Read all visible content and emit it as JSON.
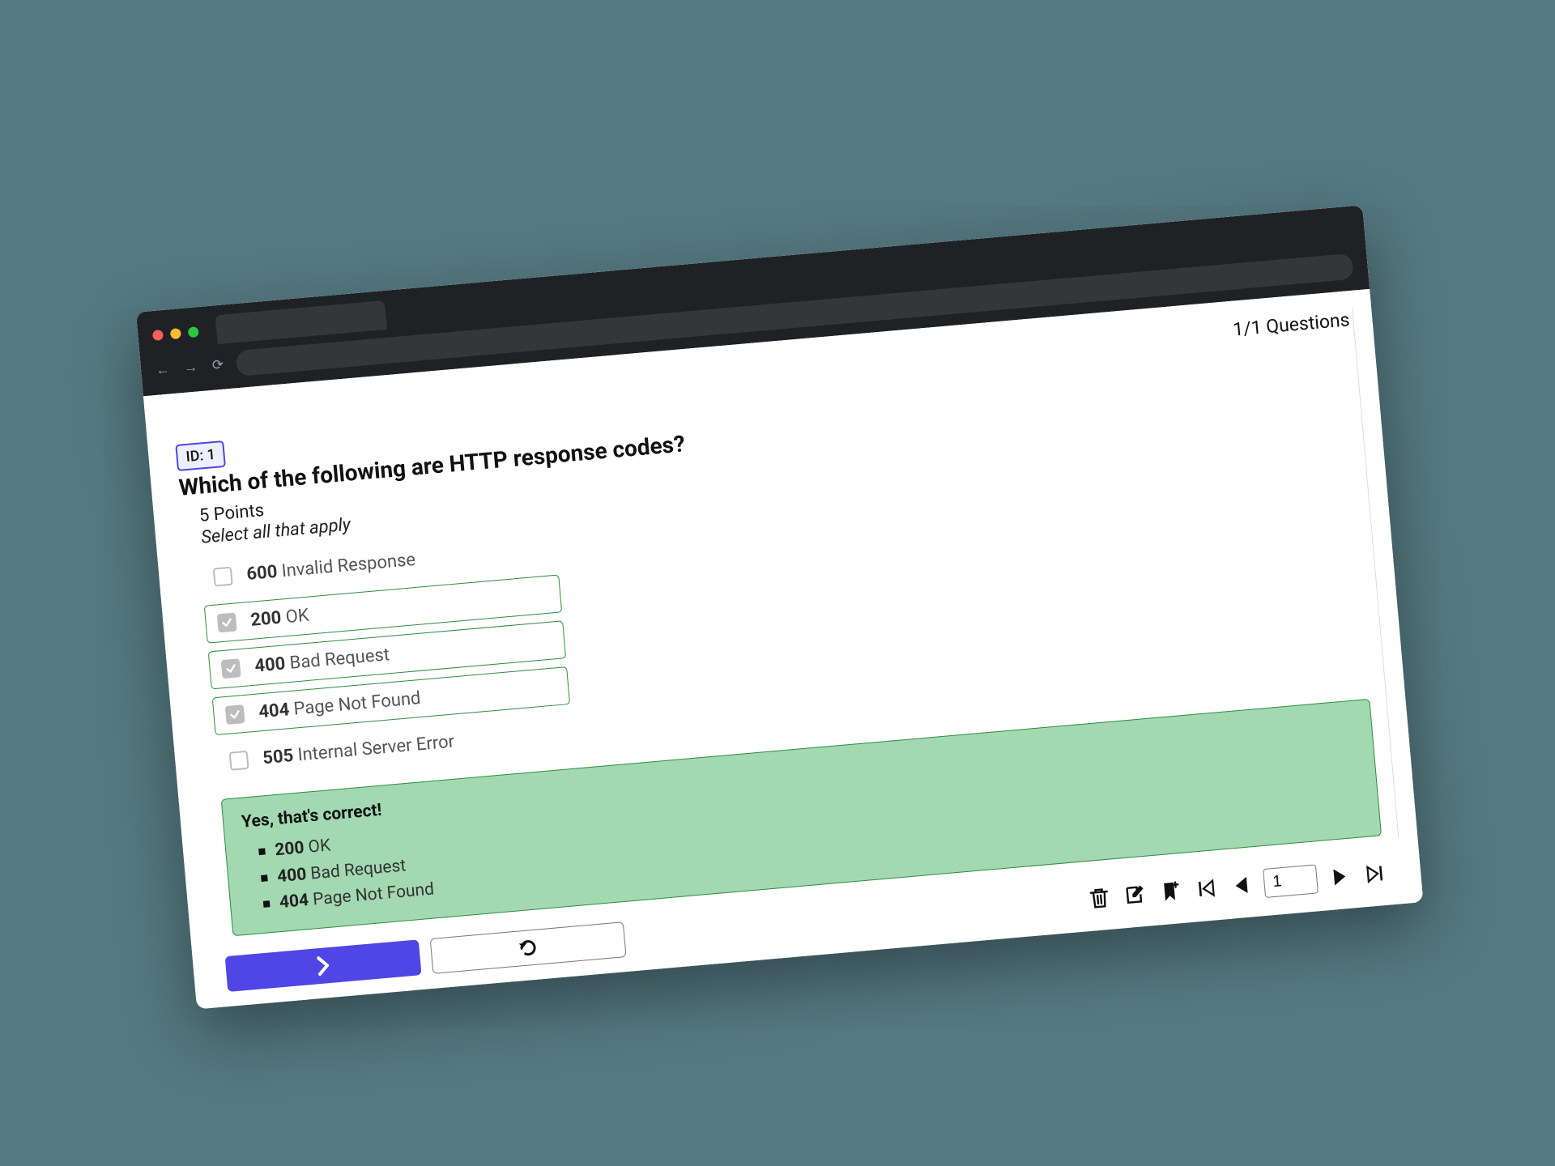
{
  "header": {
    "questions_counter": "1/1 Questions"
  },
  "question": {
    "id_label": "ID: 1",
    "title": "Which of the following are HTTP response codes?",
    "points_text": "5 Points",
    "instructions": "Select all that apply"
  },
  "answers": [
    {
      "code": "600",
      "text": "Invalid Response",
      "checked": false,
      "correct": false
    },
    {
      "code": "200",
      "text": "OK",
      "checked": true,
      "correct": true
    },
    {
      "code": "400",
      "text": "Bad Request",
      "checked": true,
      "correct": true
    },
    {
      "code": "404",
      "text": "Page Not Found",
      "checked": true,
      "correct": true
    },
    {
      "code": "505",
      "text": "Internal Server Error",
      "checked": false,
      "correct": false
    }
  ],
  "feedback": {
    "title": "Yes, that's correct!",
    "items": [
      {
        "code": "200",
        "text": "OK"
      },
      {
        "code": "400",
        "text": "Bad Request"
      },
      {
        "code": "404",
        "text": "Page Not Found"
      }
    ]
  },
  "toolbar": {
    "page_value": "1"
  }
}
